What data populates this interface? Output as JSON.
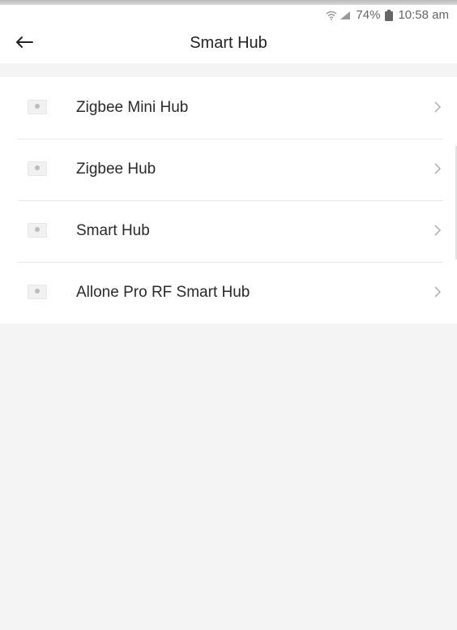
{
  "status_bar": {
    "battery": "74%",
    "time": "10:58 am",
    "icons": [
      "wifi-icon",
      "signal-icon",
      "battery-icon"
    ]
  },
  "header": {
    "title": "Smart Hub",
    "back_icon": "back-arrow-icon"
  },
  "list": {
    "items": [
      {
        "label": "Zigbee Mini Hub",
        "icon": "device-thumbnail",
        "chevron": "chevron-right-icon"
      },
      {
        "label": "Zigbee Hub",
        "icon": "device-thumbnail",
        "chevron": "chevron-right-icon"
      },
      {
        "label": "Smart Hub",
        "icon": "device-thumbnail",
        "chevron": "chevron-right-icon"
      },
      {
        "label": "Allone Pro RF Smart Hub",
        "icon": "device-thumbnail",
        "chevron": "chevron-right-icon"
      }
    ]
  },
  "colors": {
    "background": "#f4f4f4",
    "surface": "#ffffff",
    "divider": "#e8e8e8",
    "text": "#222222",
    "chevron": "#b5b5b5"
  }
}
